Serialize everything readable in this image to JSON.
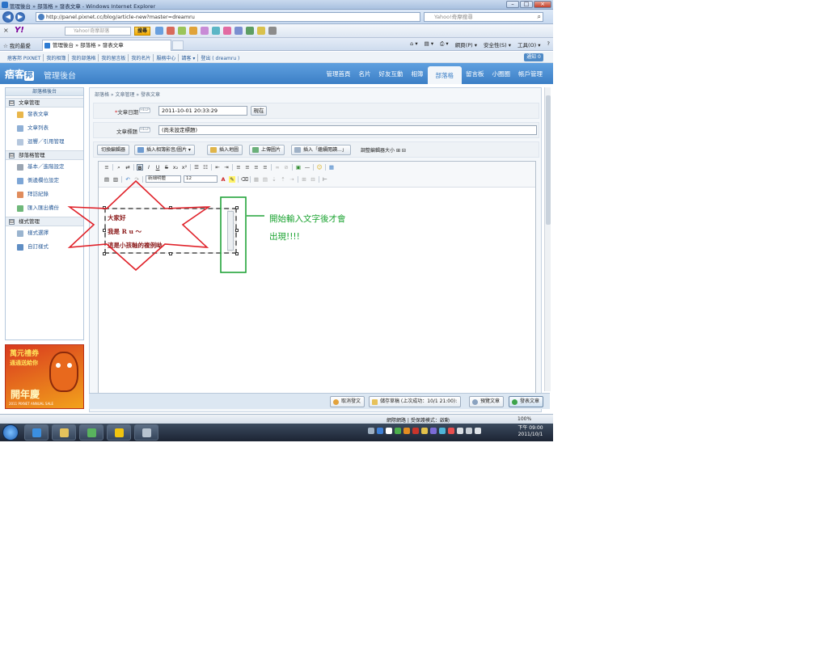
{
  "window": {
    "title": "管理後台 » 部落格 » 發表文章 - Windows Internet Explorer"
  },
  "address_bar": {
    "url": "http://panel.pixnet.cc/blog/article-new?master=dreamru",
    "search_placeholder": "Yahoo!奇摩搜尋"
  },
  "yahoo_toolbar": {
    "logo": "Y!",
    "search_placeholder": "Yahoo!奇摩部落",
    "search_button": "搜尋"
  },
  "tabs": {
    "favorites": "我的最愛",
    "active_tab": "管理後台 » 部落格 » 發表文章"
  },
  "command_bar": {
    "page": "網頁(P) ▾",
    "safety": "安全性(S) ▾",
    "tools": "工具(O) ▾",
    "help": "?"
  },
  "top_links": {
    "items": [
      "痞客邦 PIXNET",
      "我的相簿",
      "我的部落格",
      "我的留言板",
      "我的名片",
      "服務中心",
      "請客 ▾",
      "登出 ( dreamru )"
    ],
    "notice": "通知 0"
  },
  "header": {
    "logo_text": "痞客",
    "logo_mark": "邦",
    "subtitle": "管理後台",
    "nav": [
      "管理首頁",
      "名片",
      "好友互動",
      "相簿",
      "部落格",
      "留言板",
      "小圈圈",
      "帳戶管理"
    ],
    "active_nav_index": 4
  },
  "sidebar": {
    "title": "部落格後台",
    "sections": [
      {
        "label": "文章管理",
        "toggle": "⊟",
        "items": [
          "發表文章",
          "文章列表",
          "迴響／引用管理"
        ]
      },
      {
        "label": "部落格管理",
        "toggle": "⊟",
        "items": [
          "基本／進階設定",
          "側邊欄位設定",
          "拜訪紀錄",
          "匯入匯出備份"
        ]
      },
      {
        "label": "樣式管理",
        "toggle": "⊟",
        "items": [
          "樣式選擇",
          "自訂樣式"
        ]
      }
    ],
    "banner": {
      "text1": "萬元禮券",
      "text2": "通通送給你",
      "text3": "開年慶",
      "small": "2011 PIXNET ANNUAL SALE"
    }
  },
  "content": {
    "breadcrumb": "部落格 » 文章管理 » 發表文章",
    "date_label": "文章日期",
    "date_required": "*",
    "help": "HELP",
    "date_value": "2011-10-01 20:33:29",
    "now_button": "現在",
    "title_label": "文章標題",
    "title_value": "(尚未設定標題)",
    "tool_buttons": [
      "切換編輯器",
      "插入相簿影音/圖片 ▾",
      "插入地圖",
      "上傳圖片",
      "插入「繼續閱讀...」"
    ],
    "resize_label": "調整編輯器大小",
    "resize_controls": "⊞ ⊟",
    "font_select": "新細明體",
    "size_select": "12",
    "editor_lines": [
      "大家好",
      "我是 R u ～",
      "這是小孩軸的複例呦"
    ]
  },
  "annotation": {
    "line1": "開始輸入文字後才會",
    "line2": "出現!!!!"
  },
  "bottom_buttons": {
    "cancel": "取消發文",
    "draft": "儲存草稿 (上次成功：10/1 21:00):",
    "preview": "預覽文章",
    "publish": "發表文章"
  },
  "status_bar": {
    "zone": "網際網路 | 受保護模式：啟動",
    "zoom": "100%"
  },
  "taskbar": {
    "time": "下午 09:00",
    "date": "2011/10/1"
  }
}
